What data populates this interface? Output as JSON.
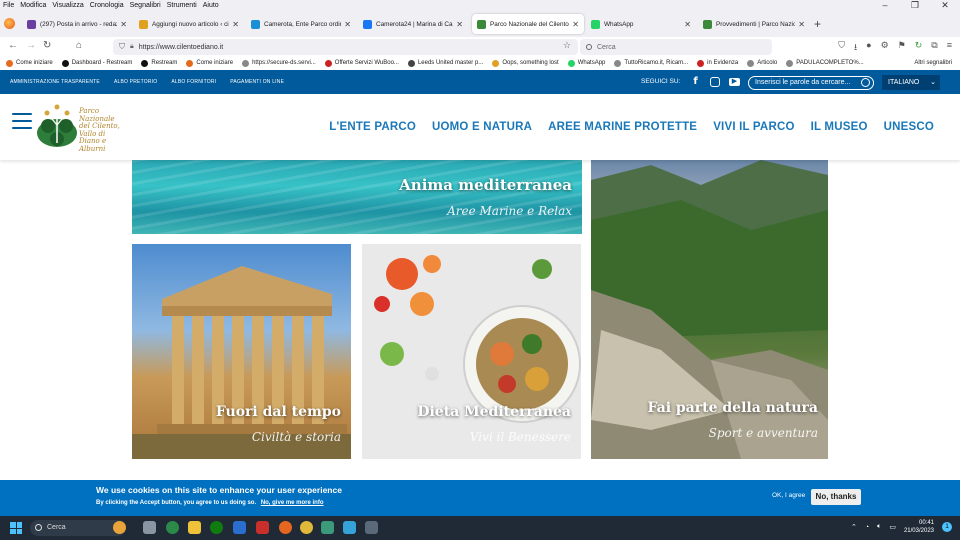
{
  "menubar": {
    "items": [
      "File",
      "Modifica",
      "Visualizza",
      "Cronologia",
      "Segnalibri",
      "Strumenti",
      "Aiuto"
    ],
    "window_controls": [
      "–",
      "❐",
      "✕"
    ]
  },
  "tabs": [
    {
      "title": "(297) Posta in arrivo - redazione",
      "color": "#6b3fa0"
    },
    {
      "title": "Aggiungi nuovo articolo ‹ cilento",
      "color": "#e0a020"
    },
    {
      "title": "Camerota, Ente Parco ordina vi",
      "color": "#1a8fd6"
    },
    {
      "title": "Camerota24 | Marina di Camero",
      "color": "#1877f2"
    },
    {
      "title": "Parco Nazionale del Cilento, Val",
      "color": "#3a8a3a"
    },
    {
      "title": "WhatsApp",
      "color": "#25d366"
    },
    {
      "title": "Provvedimenti | Parco Nazional",
      "color": "#3a8a3a"
    }
  ],
  "navbar": {
    "url": "https://www.cilentoediano.it",
    "search_placeholder": "Cerca"
  },
  "bookmarks": [
    {
      "label": "Come iniziare",
      "color": "#e66a1b"
    },
    {
      "label": "Dashboard - Restream",
      "color": "#111111"
    },
    {
      "label": "Restream",
      "color": "#111111"
    },
    {
      "label": "Come iniziare",
      "color": "#e66a1b"
    },
    {
      "label": "https://secure-ds.servi...",
      "color": "#888888"
    },
    {
      "label": "Offerte Servizi WuBoo...",
      "color": "#cc2222"
    },
    {
      "label": "Leeds United master p...",
      "color": "#444444"
    },
    {
      "label": "Oops, something lost",
      "color": "#e0a020"
    },
    {
      "label": "WhatsApp",
      "color": "#25d366"
    },
    {
      "label": "TuttoRicamo.it, Ricam...",
      "color": "#888888"
    },
    {
      "label": "in Evidenza",
      "color": "#cc2222"
    },
    {
      "label": "Articolo",
      "color": "#888888"
    },
    {
      "label": "PADULACOMPLETO%...",
      "color": "#888888"
    }
  ],
  "bookmarks_other": "Altri segnalibri",
  "sitebar": {
    "links": [
      "AMMINISTRAZIONE TRASPARENTE",
      "ALBO PRETORIO",
      "ALBO FORNITORI",
      "PAGAMENTI ON LINE"
    ],
    "follow": "SEGUICI SU:",
    "search_placeholder": "Inserisci le parole da cercare...",
    "language": "ITALIANO"
  },
  "logo": {
    "text": "Parco Nazionale del Cilento, Vallo di Diano e Alburni"
  },
  "mainnav": [
    "L'ENTE PARCO",
    "UOMO E NATURA",
    "AREE MARINE PROTETTE",
    "VIVI IL PARCO",
    "IL MUSEO",
    "UNESCO"
  ],
  "panels": {
    "sea": {
      "title": "Anima mediterranea",
      "subtitle": "Aree Marine e Relax"
    },
    "temple": {
      "title": "Fuori dal tempo",
      "subtitle": "Civiltà e storia"
    },
    "diet": {
      "title": "Dieta Mediterranea",
      "subtitle": "Vivi il Benessere"
    },
    "nature": {
      "title": "Fai parte della natura",
      "subtitle": "Sport e avventura"
    }
  },
  "cookie": {
    "heading": "We use cookies on this site to enhance your user experience",
    "text": "By clicking the Accept button, you agree to us doing so.",
    "link": "No, give me more info",
    "ok": "OK, I agree",
    "no": "No, thanks"
  },
  "taskbar": {
    "search": "Cerca",
    "time": "00:41",
    "date": "21/03/2023",
    "notifications": "1"
  }
}
